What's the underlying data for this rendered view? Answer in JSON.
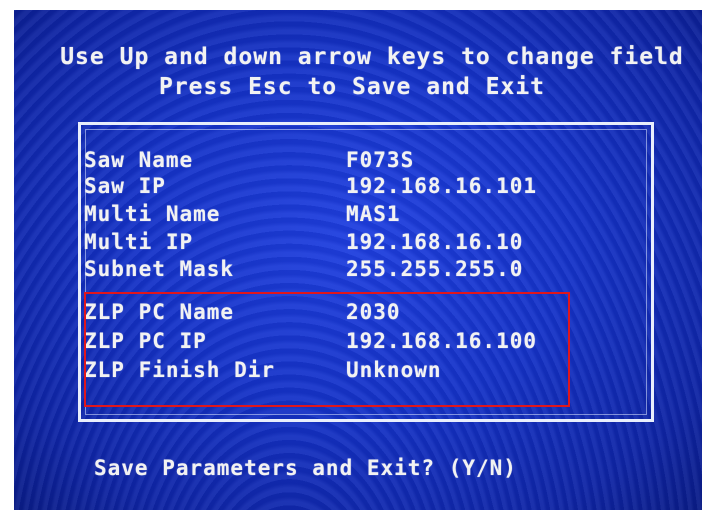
{
  "screen": {
    "instruction_line1": "Use Up and down arrow keys to change field",
    "instruction_line2": "Press Esc to Save and Exit",
    "fields": [
      {
        "label": "Saw Name",
        "value": "F073S"
      },
      {
        "label": "Saw IP",
        "value": "192.168.16.101"
      },
      {
        "label": "Multi Name",
        "value": "MAS1"
      },
      {
        "label": "Multi IP",
        "value": "192.168.16.10"
      },
      {
        "label": "Subnet Mask",
        "value": "255.255.255.0"
      },
      {
        "label": "ZLP PC Name",
        "value": "2030"
      },
      {
        "label": "ZLP PC IP",
        "value": "192.168.16.100"
      },
      {
        "label": "ZLP Finish Dir",
        "value": "Unknown"
      }
    ],
    "save_prompt": "Save Parameters and Exit? (Y/N)"
  },
  "colors": {
    "screen_bg": "#1533c8",
    "text": "#f2f2f2",
    "highlight_border": "#e0161c"
  }
}
